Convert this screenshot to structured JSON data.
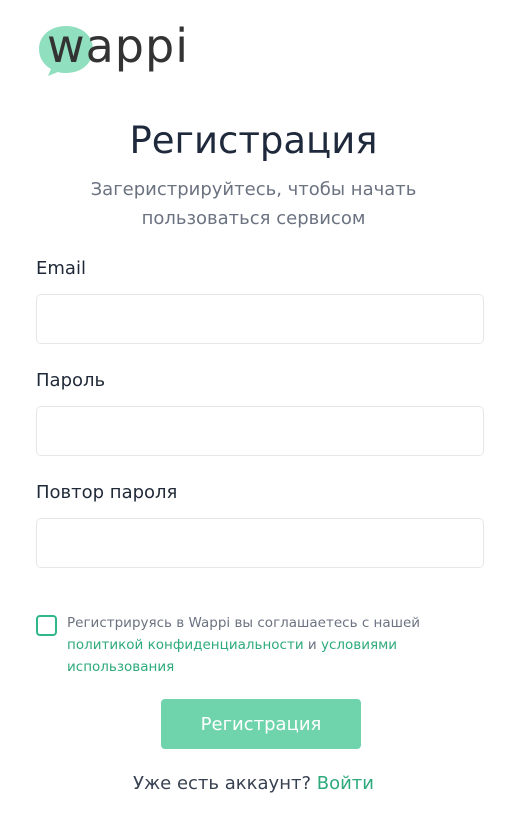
{
  "brand": {
    "logo_text": "wappi",
    "accent_color": "#2eaa7c",
    "bubble_color": "#6fd4ac"
  },
  "header": {
    "title": "Регистрация",
    "subtitle": "Загеристрируйтесь, чтобы начать пользоваться сервисом"
  },
  "form": {
    "email_label": "Email",
    "email_value": "",
    "password_label": "Пароль",
    "password_value": "",
    "password_repeat_label": "Повтор пароля",
    "password_repeat_value": ""
  },
  "consent": {
    "checked": false,
    "text_before": "Регистрируясь в Wappi вы соглашаетесь с нашей ",
    "privacy_link": "политикой конфиденциальности",
    "and_text": " и ",
    "terms_link": "условиями использования"
  },
  "actions": {
    "submit_label": "Регистрация",
    "has_account_text": "Уже есть аккаунт? ",
    "login_link": "Войти"
  }
}
